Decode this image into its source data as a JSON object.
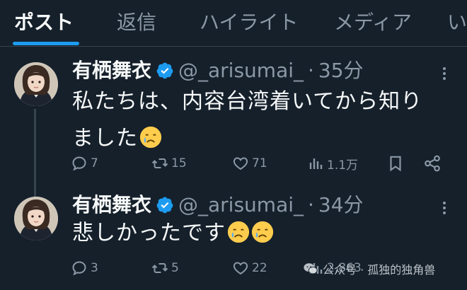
{
  "tabs": [
    {
      "label": "ポスト",
      "active": true
    },
    {
      "label": "返信",
      "active": false
    },
    {
      "label": "ハイライト",
      "active": false
    },
    {
      "label": "メディア",
      "active": false
    },
    {
      "label": "い",
      "active": false
    }
  ],
  "colors": {
    "background": "#15202b",
    "accent": "#1d9bf0",
    "muted_text": "#8b98a5",
    "text": "#f7f9f9"
  },
  "tweets": [
    {
      "author_name": "有栖舞衣",
      "handle": "@_arisumai_",
      "separator": "·",
      "time": "35分",
      "text": "私たちは、内容台湾着いてから知りました",
      "emoji": [
        "crying-face"
      ],
      "replies": "7",
      "reposts": "15",
      "likes": "71",
      "views": "1.1万"
    },
    {
      "author_name": "有栖舞衣",
      "handle": "@_arisumai_",
      "separator": "·",
      "time": "34分",
      "text": "悲しかったです",
      "emoji": [
        "crying-face",
        "crying-face"
      ],
      "replies": "3",
      "reposts": "5",
      "likes": "22",
      "views": "2,863"
    }
  ],
  "watermark": {
    "text": "公众号 · 孤独的独角兽",
    "icon": "wechat-icon"
  }
}
